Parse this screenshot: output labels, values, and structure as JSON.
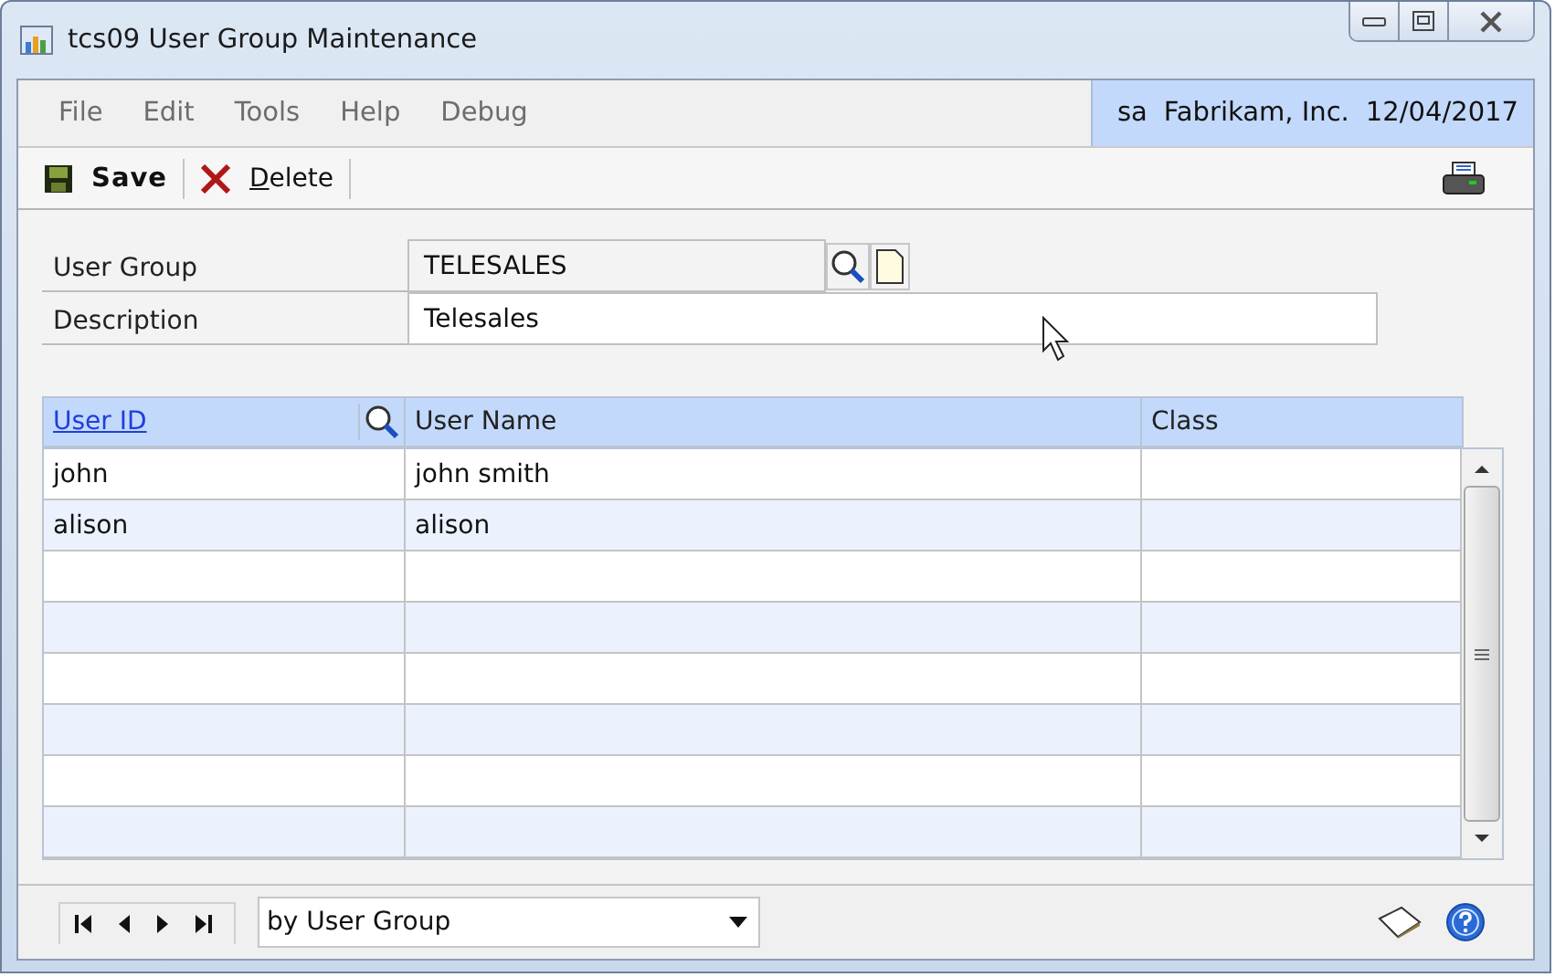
{
  "window": {
    "title": "tcs09 User Group Maintenance"
  },
  "menu": [
    "File",
    "Edit",
    "Tools",
    "Help",
    "Debug"
  ],
  "session": {
    "user": "sa",
    "company": "Fabrikam, Inc.",
    "date": "12/04/2017"
  },
  "toolbar": [
    {
      "kind": "save",
      "label": "Save"
    },
    {
      "kind": "delete",
      "label": "Delete"
    }
  ],
  "fields": [
    {
      "label": "User Group",
      "value": "TELESALES",
      "kind": "lookup"
    },
    {
      "label": "Description",
      "value": "Telesales",
      "kind": "text"
    }
  ],
  "table": {
    "columns": [
      {
        "label": "User ID",
        "kind": "link"
      },
      {
        "label": "User Name",
        "kind": "plain"
      },
      {
        "label": "Class",
        "kind": "plain"
      }
    ],
    "rows": [
      {
        "cells": [
          "john",
          "john smith"
        ]
      },
      {
        "cells": [
          "alison",
          "alison"
        ]
      }
    ]
  },
  "status_bar": {
    "sort": "by User Group"
  }
}
